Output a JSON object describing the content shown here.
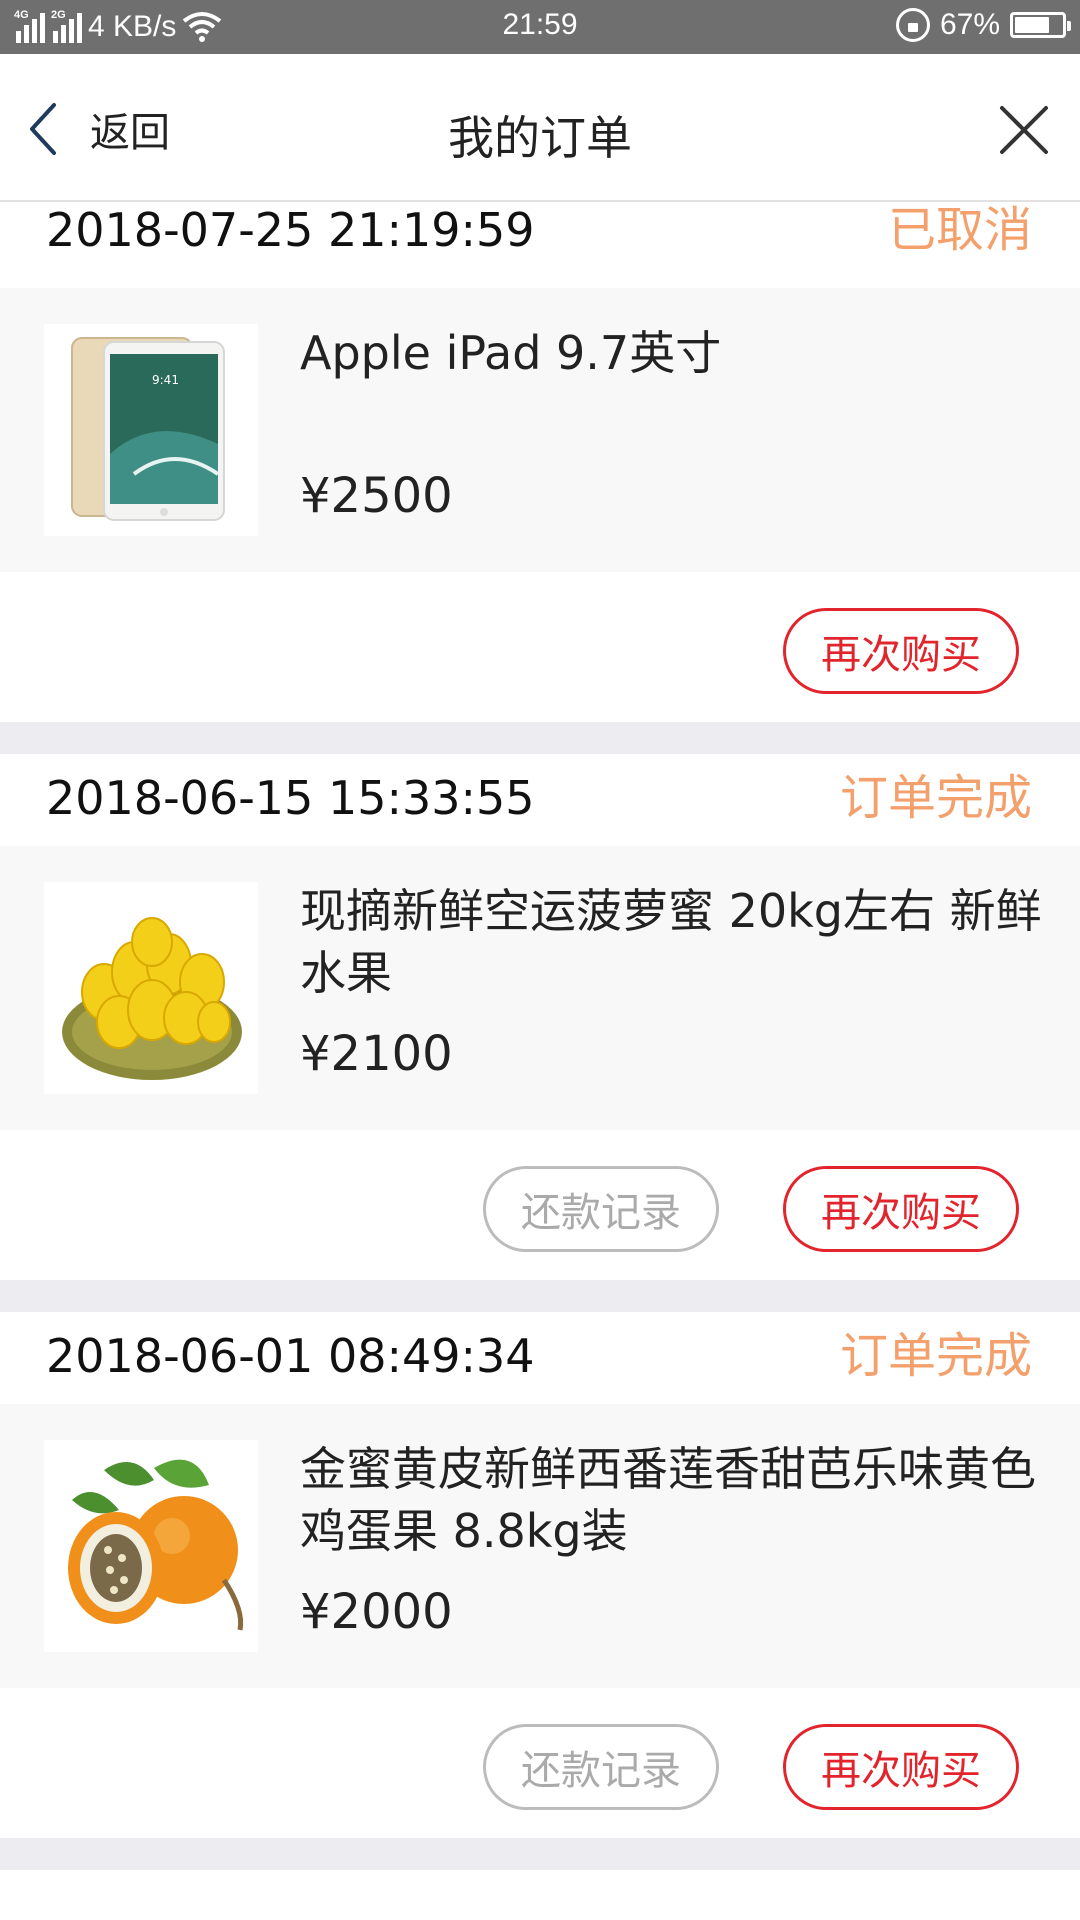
{
  "status_bar": {
    "net1": "4G",
    "net2": "2G",
    "speed": "4 KB/s",
    "time": "21:59",
    "battery": "67%",
    "battery_level": 0.67
  },
  "nav": {
    "back_label": "返回",
    "title": "我的订单"
  },
  "orders": [
    {
      "time": "2018-07-25 21:19:59",
      "status": "已取消",
      "product_name": "Apple iPad 9.7英寸",
      "price": "¥2500",
      "buttons": {
        "buy_again": "再次购买"
      }
    },
    {
      "time": "2018-06-15 15:33:55",
      "status": "订单完成",
      "product_name": "现摘新鲜空运菠萝蜜 20kg左右 新鲜水果",
      "price": "¥2100",
      "buttons": {
        "repay_record": "还款记录",
        "buy_again": "再次购买"
      }
    },
    {
      "time": "2018-06-01 08:49:34",
      "status": "订单完成",
      "product_name": "金蜜黄皮新鲜西番莲香甜芭乐味黄色鸡蛋果 8.8kg装",
      "price": "¥2000",
      "buttons": {
        "repay_record": "还款记录",
        "buy_again": "再次购买"
      }
    }
  ],
  "colors": {
    "status_text": "#f3a06c",
    "buy_again": "#e2242c",
    "repay_record": "#aaaaaa",
    "divider": "#ececf1"
  }
}
